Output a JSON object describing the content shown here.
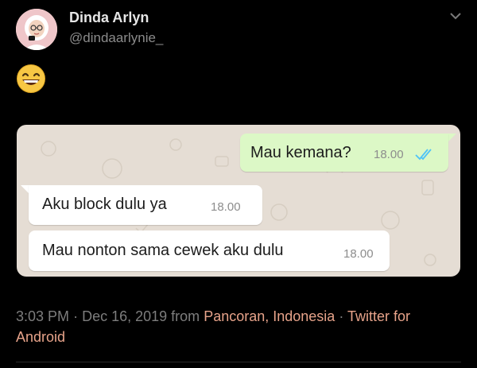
{
  "author": {
    "name": "Dinda Arlyn",
    "handle": "@dindaarlynie_"
  },
  "tweet": {
    "emoji": "😄"
  },
  "chat": {
    "messages": [
      {
        "text": "Mau kemana?",
        "time": "18.00",
        "direction": "outgoing",
        "status": "read-double-check"
      },
      {
        "text": "Aku block dulu ya",
        "time": "18.00",
        "direction": "incoming"
      },
      {
        "text": "Mau nonton sama cewek aku dulu",
        "time": "18.00",
        "direction": "incoming"
      }
    ]
  },
  "meta": {
    "time": "3:03 PM",
    "separator": "·",
    "date": "Dec 16, 2019",
    "from_label": "from",
    "location": "Pancoran, Indonesia",
    "source": "Twitter for Android"
  },
  "colors": {
    "background": "#000000",
    "link": "#e7a38a",
    "outgoing_bubble": "#dcf8c6",
    "incoming_bubble": "#ffffff",
    "chat_background": "#e5ddd4",
    "read_ticks": "#4fc3f7"
  },
  "icons": [
    "avatar",
    "chevron-down-icon",
    "grinning-emoji",
    "double-check-icon"
  ]
}
